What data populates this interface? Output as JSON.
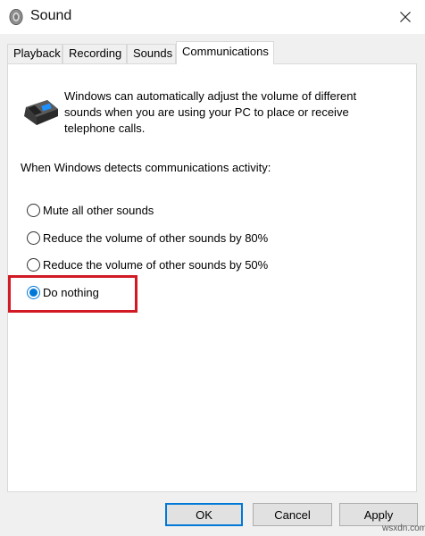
{
  "window": {
    "title": "Sound",
    "icon": "speaker-icon",
    "close_icon": "close-icon"
  },
  "tabs": [
    {
      "label": "Playback",
      "active": false
    },
    {
      "label": "Recording",
      "active": false
    },
    {
      "label": "Sounds",
      "active": false
    },
    {
      "label": "Communications",
      "active": true
    }
  ],
  "communications": {
    "icon": "telephone-icon",
    "description_lines": [
      "Windows can automatically adjust the volume of different",
      "sounds when you are using your PC to place or receive",
      "telephone calls."
    ],
    "prompt": "When Windows detects communications activity:",
    "options": [
      {
        "label": "Mute all other sounds",
        "checked": false
      },
      {
        "label": "Reduce the volume of other sounds by 80%",
        "checked": false
      },
      {
        "label": "Reduce the volume of other sounds by 50%",
        "checked": false
      },
      {
        "label": "Do nothing",
        "checked": true
      }
    ]
  },
  "buttons": {
    "ok": "OK",
    "cancel": "Cancel",
    "apply": "Apply"
  },
  "watermark": "wsxdn.com",
  "colors": {
    "accent": "#0078d7",
    "highlight_box": "#d11a24",
    "dialog_background": "#f0f0f0"
  }
}
